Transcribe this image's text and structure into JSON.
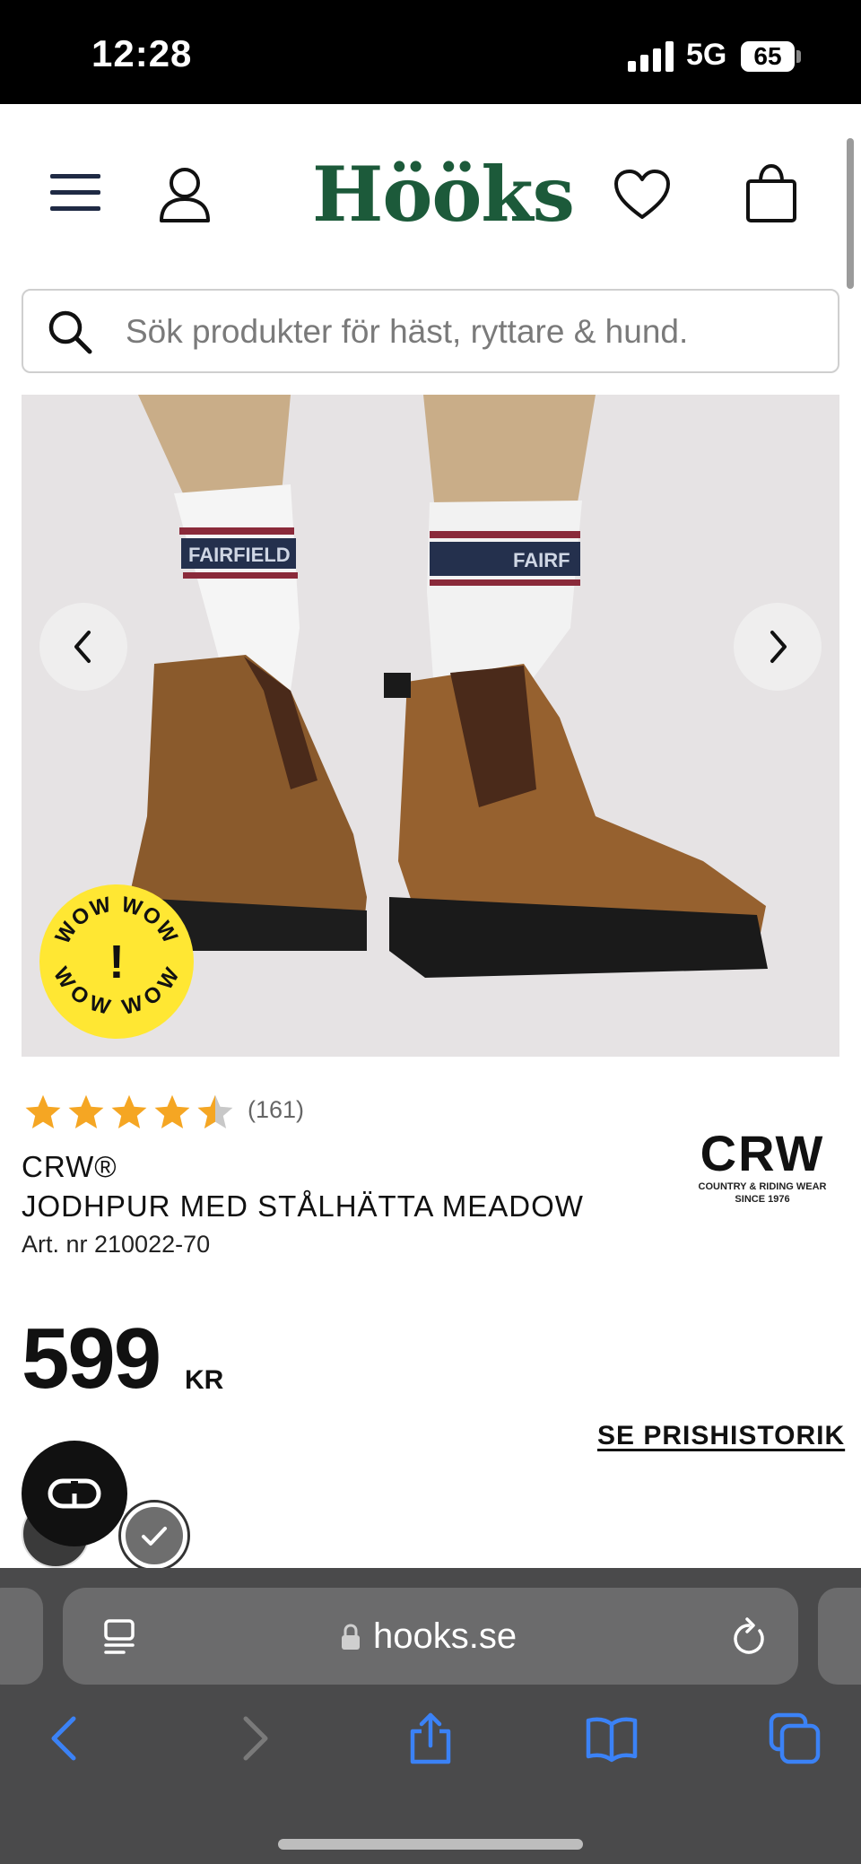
{
  "status_bar": {
    "time": "12:28",
    "network": "5G",
    "battery": "65"
  },
  "header": {
    "logo": "Hööks",
    "icons": [
      "menu-icon",
      "user-icon",
      "heart-icon",
      "shopping-bag-icon"
    ],
    "brand_color": "#1c5a3a"
  },
  "search": {
    "placeholder": "Sök produkter för häst, ryttare & hund."
  },
  "product": {
    "badge_top": "WOW WOW",
    "badge_bottom": "WOW WOW",
    "badge_mark": "!",
    "rating_value": 4.5,
    "review_count": "(161)",
    "brand": "CRW®",
    "title": "JODHPUR MED STÅLHÄTTA MEADOW",
    "article_nr": "Art. nr 210022-70",
    "brand_logo_main": "CRW",
    "brand_logo_sub1": "COUNTRY & RIDING WEAR",
    "brand_logo_sub2": "SINCE 1976",
    "price": "599",
    "currency": "KR",
    "price_history_label": "SE PRISHISTORIK",
    "star_color": "#f5a623",
    "badge_color": "#ffe733"
  },
  "browser": {
    "url": "hooks.se",
    "toolbar_icons": [
      "back-icon",
      "forward-icon",
      "share-icon",
      "bookmarks-icon",
      "tabs-icon"
    ],
    "accent": "#3b82f6"
  }
}
